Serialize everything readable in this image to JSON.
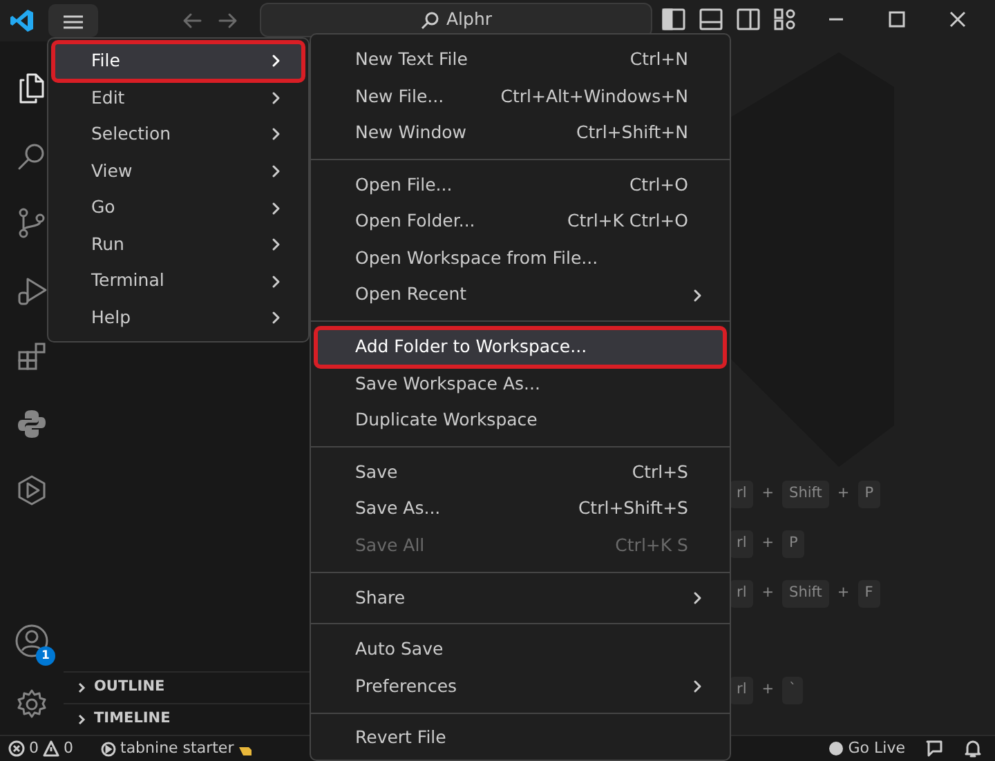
{
  "title_bar": {
    "search": "Alphr"
  },
  "activity_bar": {
    "items": [
      {
        "kind": "files",
        "selected": true
      },
      {
        "kind": "search",
        "selected": false
      },
      {
        "kind": "source-control",
        "selected": false
      },
      {
        "kind": "run",
        "selected": false
      },
      {
        "kind": "extensions",
        "selected": false
      },
      {
        "kind": "python",
        "selected": false
      },
      {
        "kind": "hexagon",
        "selected": false
      }
    ],
    "account_badge": "1"
  },
  "sidebar": {
    "sections": [
      {
        "label": "OUTLINE",
        "expanded": false
      },
      {
        "label": "TIMELINE",
        "expanded": false
      }
    ]
  },
  "menu": {
    "items": [
      {
        "label": "File",
        "selected": true
      },
      {
        "label": "Edit",
        "selected": false
      },
      {
        "label": "Selection",
        "selected": false
      },
      {
        "label": "View",
        "selected": false
      },
      {
        "label": "Go",
        "selected": false
      },
      {
        "label": "Run",
        "selected": false
      },
      {
        "label": "Terminal",
        "selected": false
      },
      {
        "label": "Help",
        "selected": false
      }
    ]
  },
  "submenu": {
    "groups": [
      [
        {
          "label": "New Text File",
          "shortcut": "Ctrl+N",
          "selected": false,
          "disabled": false,
          "has_submenu": false
        },
        {
          "label": "New File...",
          "shortcut": "Ctrl+Alt+Windows+N",
          "selected": false,
          "disabled": false,
          "has_submenu": false
        },
        {
          "label": "New Window",
          "shortcut": "Ctrl+Shift+N",
          "selected": false,
          "disabled": false,
          "has_submenu": false
        }
      ],
      [
        {
          "label": "Open File...",
          "shortcut": "Ctrl+O",
          "selected": false,
          "disabled": false,
          "has_submenu": false
        },
        {
          "label": "Open Folder...",
          "shortcut": "Ctrl+K Ctrl+O",
          "selected": false,
          "disabled": false,
          "has_submenu": false
        },
        {
          "label": "Open Workspace from File...",
          "selected": false,
          "disabled": false,
          "has_submenu": false
        },
        {
          "label": "Open Recent",
          "selected": false,
          "disabled": false,
          "has_submenu": true
        }
      ],
      [
        {
          "label": "Add Folder to Workspace...",
          "selected": true,
          "disabled": false,
          "has_submenu": false
        },
        {
          "label": "Save Workspace As...",
          "selected": false,
          "disabled": false,
          "has_submenu": false
        },
        {
          "label": "Duplicate Workspace",
          "selected": false,
          "disabled": false,
          "has_submenu": false
        }
      ],
      [
        {
          "label": "Save",
          "shortcut": "Ctrl+S",
          "selected": false,
          "disabled": false,
          "has_submenu": false
        },
        {
          "label": "Save As...",
          "shortcut": "Ctrl+Shift+S",
          "selected": false,
          "disabled": false,
          "has_submenu": false
        },
        {
          "label": "Save All",
          "shortcut": "Ctrl+K S",
          "selected": false,
          "disabled": true,
          "has_submenu": false
        }
      ],
      [
        {
          "label": "Share",
          "selected": false,
          "disabled": false,
          "has_submenu": true
        }
      ],
      [
        {
          "label": "Auto Save",
          "selected": false,
          "disabled": false,
          "has_submenu": false
        },
        {
          "label": "Preferences",
          "selected": false,
          "disabled": false,
          "has_submenu": true
        }
      ],
      [
        {
          "label": "Revert File",
          "selected": false,
          "disabled": false,
          "has_submenu": false
        }
      ]
    ]
  },
  "editor": {
    "shortcut_hints": [
      [
        {
          "kind": "key",
          "text": "rl"
        },
        {
          "kind": "plus",
          "text": "+"
        },
        {
          "kind": "key",
          "text": "Shift"
        },
        {
          "kind": "plus",
          "text": "+"
        },
        {
          "kind": "key",
          "text": "P"
        }
      ],
      [
        {
          "kind": "key",
          "text": "rl"
        },
        {
          "kind": "plus",
          "text": "+"
        },
        {
          "kind": "key",
          "text": "P"
        }
      ],
      [
        {
          "kind": "key",
          "text": "rl"
        },
        {
          "kind": "plus",
          "text": "+"
        },
        {
          "kind": "key",
          "text": "Shift"
        },
        {
          "kind": "plus",
          "text": "+"
        },
        {
          "kind": "key",
          "text": "F"
        }
      ],
      [
        {
          "kind": "key",
          "text": "rl"
        },
        {
          "kind": "plus",
          "text": "+"
        },
        {
          "kind": "key",
          "text": "`"
        }
      ]
    ]
  },
  "status_bar": {
    "errors": "0",
    "warnings": "0",
    "tabnine": "tabnine starter",
    "go_live": "Go Live"
  }
}
